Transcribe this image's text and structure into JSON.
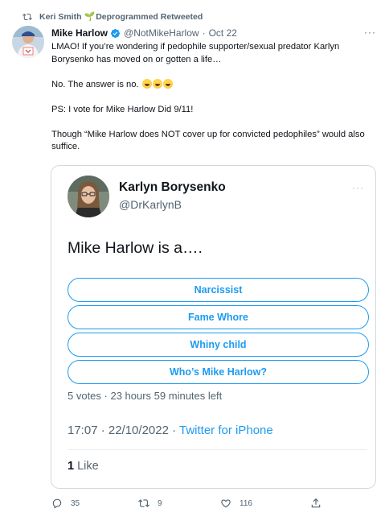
{
  "retweet": {
    "user": "Keri Smith",
    "suffix": "Deprogrammed Retweeted"
  },
  "tweet": {
    "author_name": "Mike Harlow",
    "handle": "@NotMikeHarlow",
    "separator": "·",
    "date": "Oct 22",
    "more": "···",
    "paragraphs": [
      "LMAO! If you’re wondering if pedophile supporter/sexual predator Karlyn Borysenko has moved on or gotten a life…",
      "No. The answer is no.",
      "PS: I vote for Mike Harlow Did 9/11!",
      "Though “Mike Harlow does NOT cover up for convicted pedophiles” would also suffice."
    ]
  },
  "quoted": {
    "author_name": "Karlyn Borysenko",
    "handle": "@DrKarlynB",
    "more": "···",
    "question": "Mike Harlow is a….",
    "poll_options": [
      "Narcissist",
      "Fame Whore",
      "Whiny child",
      "Who’s Mike Harlow?"
    ],
    "poll_meta": "5 votes · 23 hours 59 minutes left",
    "time": "17:07 · 22/10/2022 · ",
    "source": "Twitter for iPhone",
    "likes_count": "1",
    "likes_label": " Like"
  },
  "actions": {
    "replies": "35",
    "retweets": "9",
    "likes": "116"
  },
  "colors": {
    "accent": "#1d9bf0",
    "muted": "#536471",
    "text": "#0f1419",
    "retweet_sprout": "#17bf63"
  },
  "icons": {
    "retweet": "retweet-icon",
    "verified": "verified-badge-icon",
    "reply": "reply-icon",
    "like": "heart-icon",
    "share": "share-icon"
  }
}
